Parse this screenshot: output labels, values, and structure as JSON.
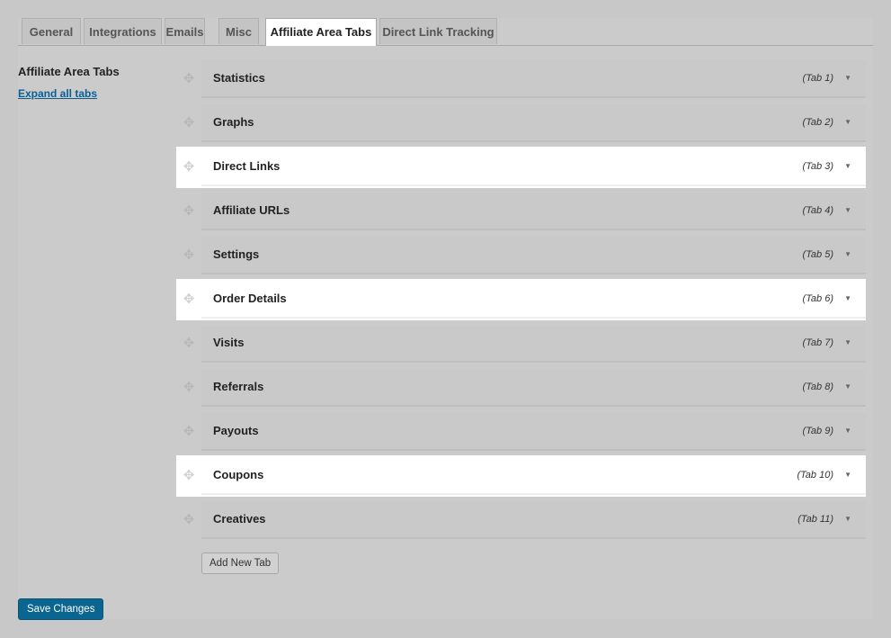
{
  "tabs": [
    {
      "label": "General"
    },
    {
      "label": "Integrations"
    },
    {
      "label": "Emails"
    },
    {
      "label": "Misc"
    },
    {
      "label": "Affiliate Area Tabs"
    },
    {
      "label": "Direct Link Tracking"
    }
  ],
  "active_tab": "Affiliate Area Tabs",
  "sidebar": {
    "title": "Affiliate Area Tabs",
    "expand_link": "Expand all tabs"
  },
  "area_tabs": [
    {
      "title": "Statistics",
      "number": "(Tab 1)",
      "highlighted": false
    },
    {
      "title": "Graphs",
      "number": "(Tab 2)",
      "highlighted": false
    },
    {
      "title": "Direct Links",
      "number": "(Tab 3)",
      "highlighted": true
    },
    {
      "title": "Affiliate URLs",
      "number": "(Tab 4)",
      "highlighted": false
    },
    {
      "title": "Settings",
      "number": "(Tab 5)",
      "highlighted": false
    },
    {
      "title": "Order Details",
      "number": "(Tab 6)",
      "highlighted": true
    },
    {
      "title": "Visits",
      "number": "(Tab 7)",
      "highlighted": false
    },
    {
      "title": "Referrals",
      "number": "(Tab 8)",
      "highlighted": false
    },
    {
      "title": "Payouts",
      "number": "(Tab 9)",
      "highlighted": false
    },
    {
      "title": "Coupons",
      "number": "(Tab 10)",
      "highlighted": true
    },
    {
      "title": "Creatives",
      "number": "(Tab 11)",
      "highlighted": false
    }
  ],
  "icons": {
    "handle": "move-handle-icon",
    "toggle": "caret-down-icon"
  },
  "buttons": {
    "add_new_tab": "Add New Tab",
    "save_changes": "Save Changes"
  },
  "colors": {
    "accent": "#0b6591",
    "link": "#0a5f93",
    "highlight_row": "#ffffff"
  }
}
